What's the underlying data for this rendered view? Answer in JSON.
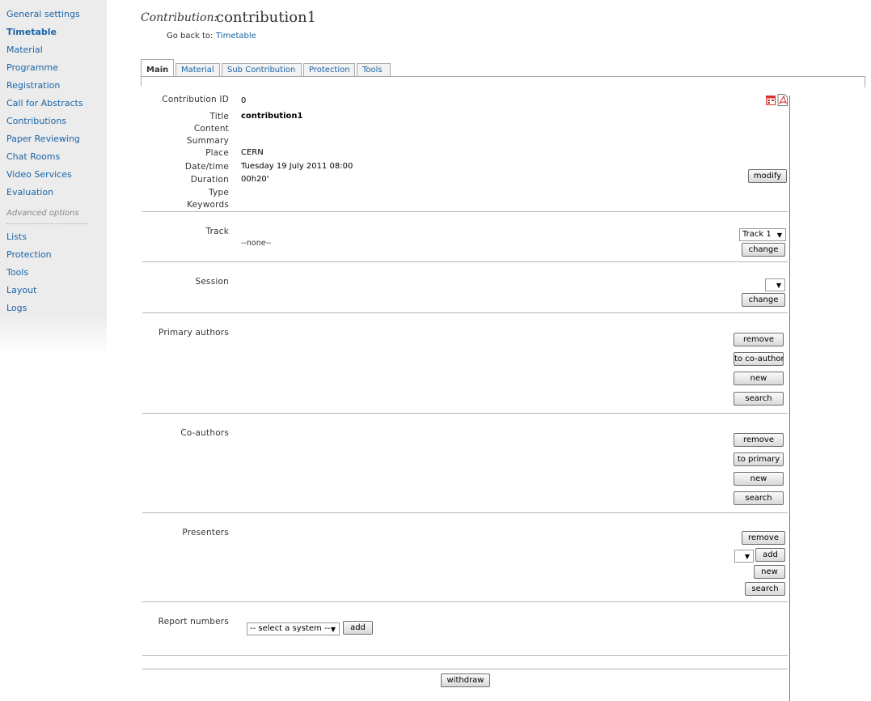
{
  "sidebar": {
    "items": [
      {
        "label": "General settings"
      },
      {
        "label": "Timetable"
      },
      {
        "label": "Material"
      },
      {
        "label": "Programme"
      },
      {
        "label": "Registration"
      },
      {
        "label": "Call for Abstracts"
      },
      {
        "label": "Contributions"
      },
      {
        "label": "Paper Reviewing"
      },
      {
        "label": "Chat Rooms"
      },
      {
        "label": "Video Services"
      },
      {
        "label": "Evaluation"
      }
    ],
    "advanced_label": "Advanced options",
    "advanced_items": [
      {
        "label": "Lists"
      },
      {
        "label": "Protection"
      },
      {
        "label": "Tools"
      },
      {
        "label": "Layout"
      },
      {
        "label": "Logs"
      }
    ]
  },
  "header": {
    "label": "Contribution:",
    "title": "contribution1",
    "goback_label": "Go back to:",
    "goback_link": "Timetable"
  },
  "tabs": [
    "Main",
    "Material",
    "Sub Contribution",
    "Protection",
    "Tools"
  ],
  "details": {
    "id_label": "Contribution ID",
    "id_value": "0",
    "title_label": "Title",
    "title_value": "contribution1",
    "content_label": "Content",
    "summary_label": "Summary",
    "place_label": "Place",
    "place_value": "CERN",
    "datetime_label": "Date/time",
    "datetime_value": "Tuesday 19 July 2011 08:00",
    "duration_label": "Duration",
    "duration_value": "00h20'",
    "type_label": "Type",
    "keywords_label": "Keywords",
    "modify_button": "modify"
  },
  "track": {
    "label": "Track",
    "value": "--none--",
    "select_value": "Track 1",
    "change_button": "change"
  },
  "session": {
    "label": "Session",
    "select_value": "",
    "change_button": "change"
  },
  "primary_authors": {
    "label": "Primary authors",
    "remove": "remove",
    "to_coauthor": "to co-author",
    "new": "new",
    "search": "search"
  },
  "coauthors": {
    "label": "Co-authors",
    "remove": "remove",
    "to_primary": "to primary",
    "new": "new",
    "search": "search"
  },
  "presenters": {
    "label": "Presenters",
    "remove": "remove",
    "add": "add",
    "new": "new",
    "search": "search"
  },
  "report_numbers": {
    "label": "Report numbers",
    "select_value": "-- select a system --",
    "add": "add"
  },
  "footer": {
    "withdraw": "withdraw"
  }
}
